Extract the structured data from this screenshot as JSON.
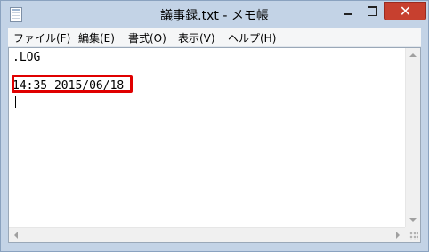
{
  "window": {
    "title": "議事録.txt - メモ帳"
  },
  "titlebar": {
    "close_glyph": "✕"
  },
  "menu": [
    {
      "label": "ファイル(F)"
    },
    {
      "label": "編集(E)"
    },
    {
      "label": "書式(O)"
    },
    {
      "label": "表示(V)"
    },
    {
      "label": "ヘルプ(H)"
    }
  ],
  "editor": {
    "lines": [
      ".LOG",
      "",
      "14:35 2015/06/18",
      ""
    ]
  },
  "colors": {
    "highlight": "#e00000",
    "close_button": "#c7402f"
  },
  "icons": [
    "notepad-icon",
    "minimize-icon",
    "maximize-icon",
    "close-icon"
  ]
}
